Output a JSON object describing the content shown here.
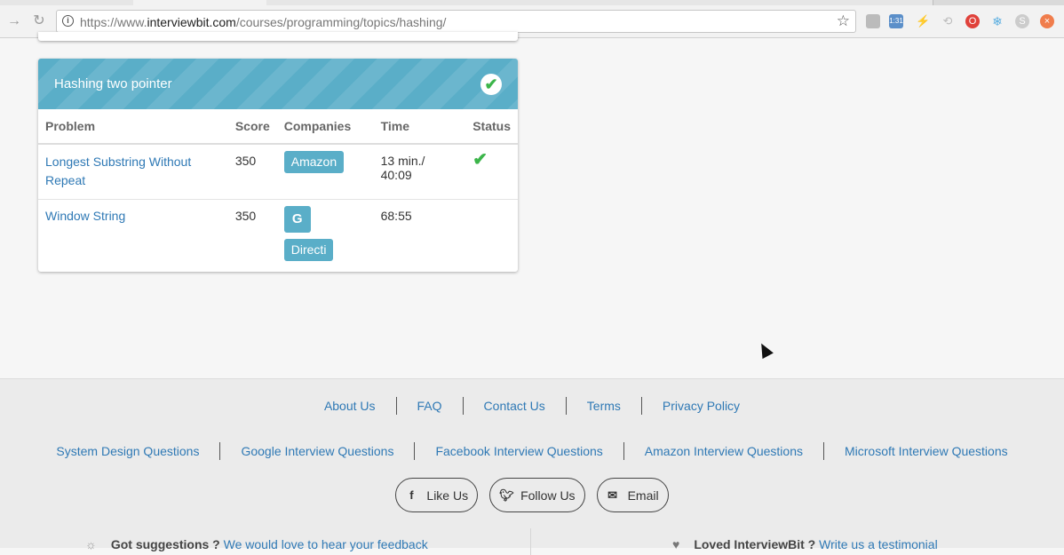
{
  "browser": {
    "url_prefix": "https://www.",
    "url_domain": "interviewbit.com",
    "url_path": "/courses/programming/topics/hashing/",
    "extensions": [
      "pocket-icon",
      "clock-icon",
      "bolt-icon",
      "sync-icon",
      "opera-icon",
      "snowflake-icon",
      "skype-icon",
      "close-circle-icon"
    ],
    "clock_badge": "1:31"
  },
  "card": {
    "title": "Hashing two pointer",
    "columns": [
      "Problem",
      "Score",
      "Companies",
      "Time",
      "Status"
    ],
    "rows": [
      {
        "problem": "Longest Substring Without Repeat",
        "score": "350",
        "companies": [
          "Amazon"
        ],
        "time": "13 min./ 40:09",
        "solved": true
      },
      {
        "problem": "Window String",
        "score": "350",
        "companies": [
          "G",
          "Directi"
        ],
        "time": "68:55",
        "solved": false
      }
    ]
  },
  "footer": {
    "row1": [
      "About Us",
      "FAQ",
      "Contact Us",
      "Terms",
      "Privacy Policy"
    ],
    "row2": [
      "System Design Questions",
      "Google Interview Questions",
      "Facebook Interview Questions",
      "Amazon Interview Questions",
      "Microsoft Interview Questions"
    ],
    "social": {
      "like": "Like Us",
      "follow": "Follow Us",
      "email": "Email"
    },
    "suggest_text": "Got suggestions ?",
    "suggest_link": "We would love to hear your feedback",
    "loved_text": "Loved InterviewBit ?",
    "loved_link": "Write us a testimonial"
  }
}
